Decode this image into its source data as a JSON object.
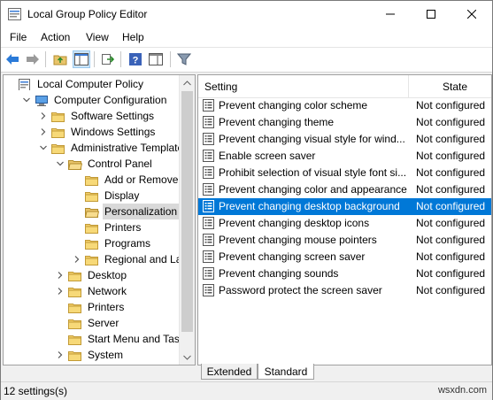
{
  "window": {
    "title": "Local Group Policy Editor"
  },
  "menu": [
    "File",
    "Action",
    "View",
    "Help"
  ],
  "tree": [
    {
      "label": "Local Computer Policy",
      "level": 0,
      "expander": "none",
      "icon": "computer-policy-icon"
    },
    {
      "label": "Computer Configuration",
      "level": 1,
      "expander": "open",
      "icon": "computer-icon"
    },
    {
      "label": "Software Settings",
      "level": 2,
      "expander": "closed",
      "icon": "folder-icon"
    },
    {
      "label": "Windows Settings",
      "level": 2,
      "expander": "closed",
      "icon": "folder-icon"
    },
    {
      "label": "Administrative Templates",
      "level": 2,
      "expander": "open",
      "icon": "folder-icon"
    },
    {
      "label": "Control Panel",
      "level": 3,
      "expander": "open",
      "icon": "folder-open-icon"
    },
    {
      "label": "Add or Remove Pr",
      "level": 4,
      "expander": "none",
      "icon": "folder-icon"
    },
    {
      "label": "Display",
      "level": 4,
      "expander": "none",
      "icon": "folder-icon"
    },
    {
      "label": "Personalization",
      "level": 4,
      "expander": "none",
      "icon": "folder-open-icon",
      "selected": true
    },
    {
      "label": "Printers",
      "level": 4,
      "expander": "none",
      "icon": "folder-icon"
    },
    {
      "label": "Programs",
      "level": 4,
      "expander": "none",
      "icon": "folder-icon"
    },
    {
      "label": "Regional and Lang",
      "level": 4,
      "expander": "closed",
      "icon": "folder-icon"
    },
    {
      "label": "Desktop",
      "level": 3,
      "expander": "closed",
      "icon": "folder-icon"
    },
    {
      "label": "Network",
      "level": 3,
      "expander": "closed",
      "icon": "folder-icon"
    },
    {
      "label": "Printers",
      "level": 3,
      "expander": "none",
      "icon": "folder-icon"
    },
    {
      "label": "Server",
      "level": 3,
      "expander": "none",
      "icon": "folder-icon"
    },
    {
      "label": "Start Menu and Taskb",
      "level": 3,
      "expander": "none",
      "icon": "folder-icon"
    },
    {
      "label": "System",
      "level": 3,
      "expander": "closed",
      "icon": "folder-icon"
    }
  ],
  "list": {
    "columns": {
      "setting": "Setting",
      "state": "State"
    },
    "rows": [
      {
        "setting": "Prevent changing color scheme",
        "state": "Not configured"
      },
      {
        "setting": "Prevent changing theme",
        "state": "Not configured"
      },
      {
        "setting": "Prevent changing visual style for wind...",
        "state": "Not configured"
      },
      {
        "setting": "Enable screen saver",
        "state": "Not configured"
      },
      {
        "setting": "Prohibit selection of visual style font si...",
        "state": "Not configured"
      },
      {
        "setting": "Prevent changing color and appearance",
        "state": "Not configured"
      },
      {
        "setting": "Prevent changing desktop background",
        "state": "Not configured",
        "selected": true
      },
      {
        "setting": "Prevent changing desktop icons",
        "state": "Not configured"
      },
      {
        "setting": "Prevent changing mouse pointers",
        "state": "Not configured"
      },
      {
        "setting": "Prevent changing screen saver",
        "state": "Not configured"
      },
      {
        "setting": "Prevent changing sounds",
        "state": "Not configured"
      },
      {
        "setting": "Password protect the screen saver",
        "state": "Not configured"
      }
    ]
  },
  "tabs": {
    "extended": "Extended",
    "standard": "Standard",
    "active": "standard"
  },
  "status": {
    "text": "12 settings(s)"
  },
  "watermark": "wsxdn.com",
  "colors": {
    "selection": "#0078d7",
    "tree_selected": "#d9d9d9",
    "folder": "#e8c46a"
  }
}
